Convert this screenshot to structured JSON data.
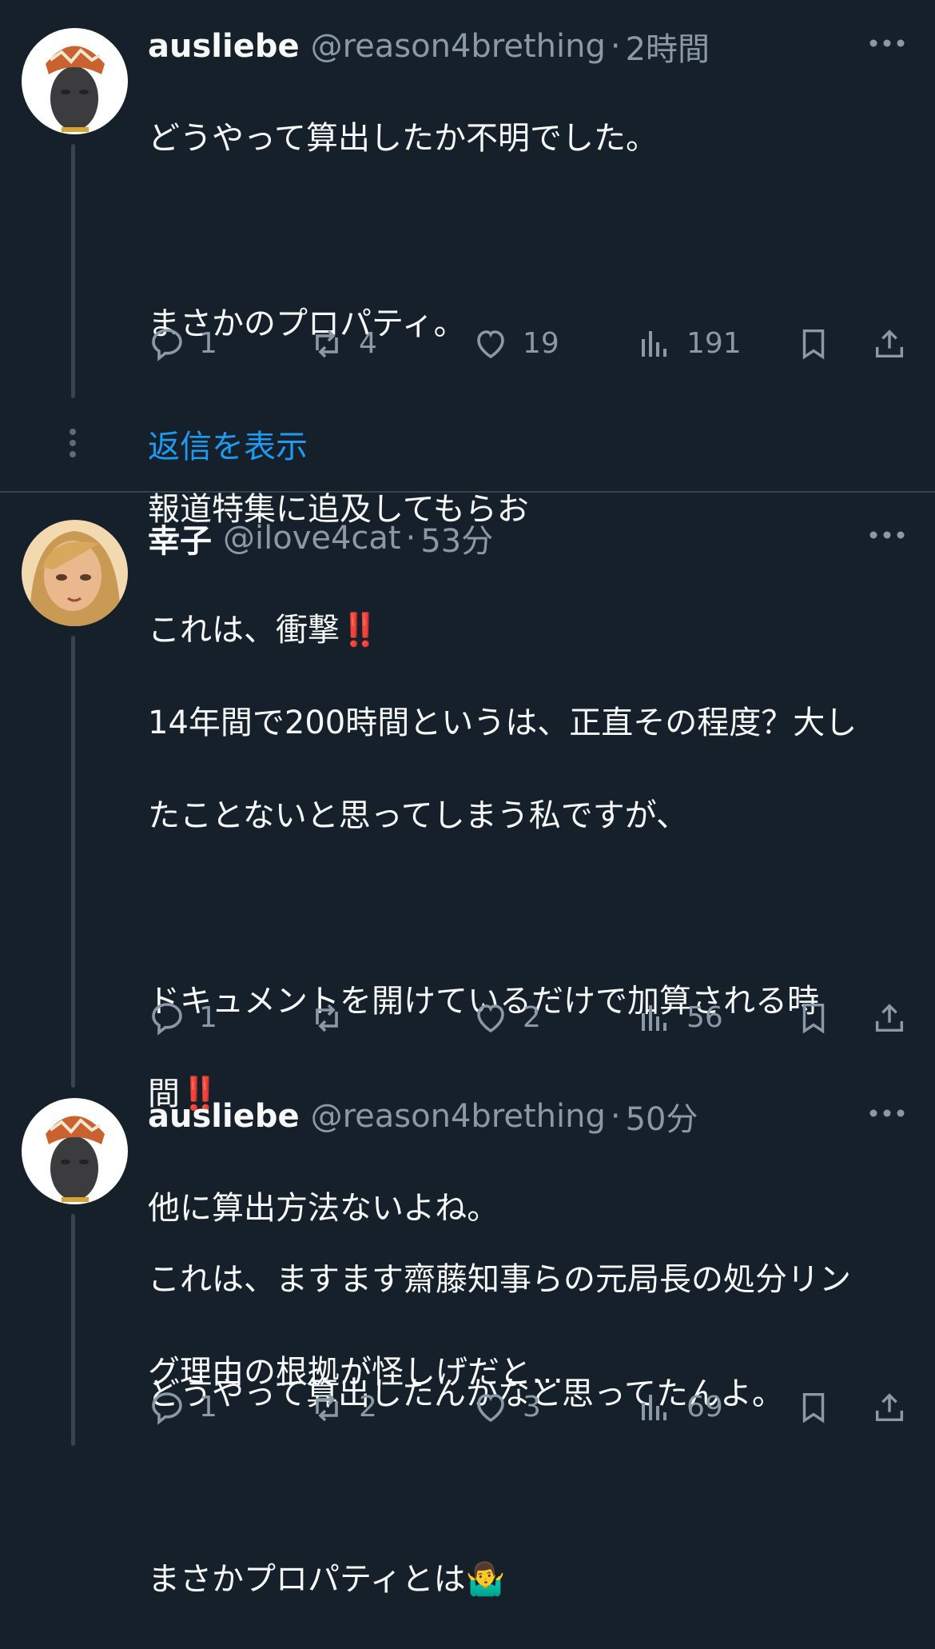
{
  "posts": [
    {
      "name": "ausliebe",
      "handle": "@reason4brething",
      "time": "2時間",
      "lines": [
        "どうやって算出したか不明でした。",
        "",
        "まさかのプロパティ。",
        "",
        "報道特集に追及してもらお"
      ],
      "stats": {
        "replies": "1",
        "reposts": "4",
        "likes": "19",
        "views": "191"
      },
      "avatar_icon": "avatar-headwrap-figure"
    },
    {
      "name": "幸子",
      "handle": "@ilove4cat",
      "time": "53分",
      "line1_text": "これは、衝撃",
      "line1_emoji": "‼️",
      "line2": "14年間で200時間というは、正直その程度？大し",
      "line3": "たことないと思ってしまう私ですが、",
      "line4": "ドキュメントを開けているだけで加算される時",
      "line5_text": "間",
      "line5_emoji": "‼️",
      "line6": "これは、ますます齋藤知事らの元局長の処分リン",
      "line7": "グ理由の根拠が怪しげだと…",
      "stats": {
        "replies": "1",
        "reposts": "",
        "likes": "2",
        "views": "56"
      },
      "avatar_icon": "avatar-anime-woman"
    },
    {
      "name": "ausliebe",
      "handle": "@reason4brething",
      "time": "50分",
      "lines": [
        "他に算出方法ないよね。",
        "",
        "どうやって算出したんかなと思ってたんよ。",
        ""
      ],
      "last_line_text": "まさかプロパティとは",
      "last_line_emoji": "🤷‍♂️",
      "stats": {
        "replies": "1",
        "reposts": "2",
        "likes": "3",
        "views": "69"
      },
      "avatar_icon": "avatar-headwrap-figure"
    }
  ],
  "show_replies_label": "返信を表示",
  "colors": {
    "background": "#15202b",
    "text": "#f7f9f9",
    "muted": "#8b98a5",
    "link": "#1d9bf0",
    "line": "#38444d"
  }
}
